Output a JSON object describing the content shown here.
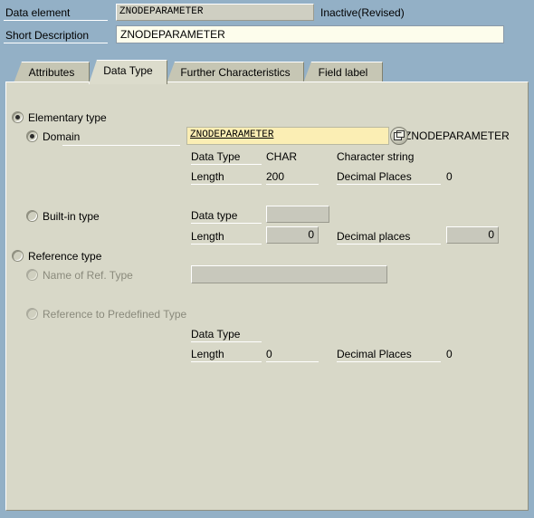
{
  "header": {
    "data_element_label": "Data element",
    "data_element_value": "ZNODEPARAMETER",
    "status": "Inactive(Revised)",
    "short_description_label": "Short Description",
    "short_description_value": "ZNODEPARAMETER",
    "short_description_placeholder": ""
  },
  "tabs": [
    {
      "label": "Attributes",
      "active": false
    },
    {
      "label": "Data Type",
      "active": true
    },
    {
      "label": "Further Characteristics",
      "active": false
    },
    {
      "label": "Field label",
      "active": false
    }
  ],
  "elementary": {
    "group_label": "Elementary type",
    "domain_label": "Domain",
    "domain_value": "ZNODEPARAMETER",
    "domain_link_text": "ZNODEPARAMETER",
    "data_type_label": "Data Type",
    "data_type_value": "CHAR",
    "data_type_description": "Character string",
    "length_label": "Length",
    "length_value": "200",
    "decimal_places_label": "Decimal Places",
    "decimal_places_value": "0"
  },
  "builtin": {
    "group_label": "Built-in type",
    "data_type_label": "Data type",
    "data_type_value": "",
    "length_label": "Length",
    "length_value": "0",
    "decimal_places_label": "Decimal places",
    "decimal_places_value": "0"
  },
  "reference": {
    "group_label": "Reference type",
    "name_label": "Name of Ref. Type",
    "name_value": "",
    "predefined_label": "Reference to Predefined Type",
    "data_type_label": "Data Type",
    "data_type_value": "",
    "length_label": "Length",
    "length_value": "0",
    "decimal_places_label": "Decimal Places",
    "decimal_places_value": "0"
  },
  "colors": {
    "header_band": "#93b0c6",
    "panel": "#d8d8c8",
    "tab_inactive": "#c6c6b4",
    "tab_active": "#dcdccc",
    "required_field": "#fbeeb4",
    "readonly_field": "#cfcfc2",
    "edit_field": "#fdfdec",
    "disabled_text": "#8a8a7c"
  },
  "icons": {
    "domain_nav": "open-object-icon"
  }
}
